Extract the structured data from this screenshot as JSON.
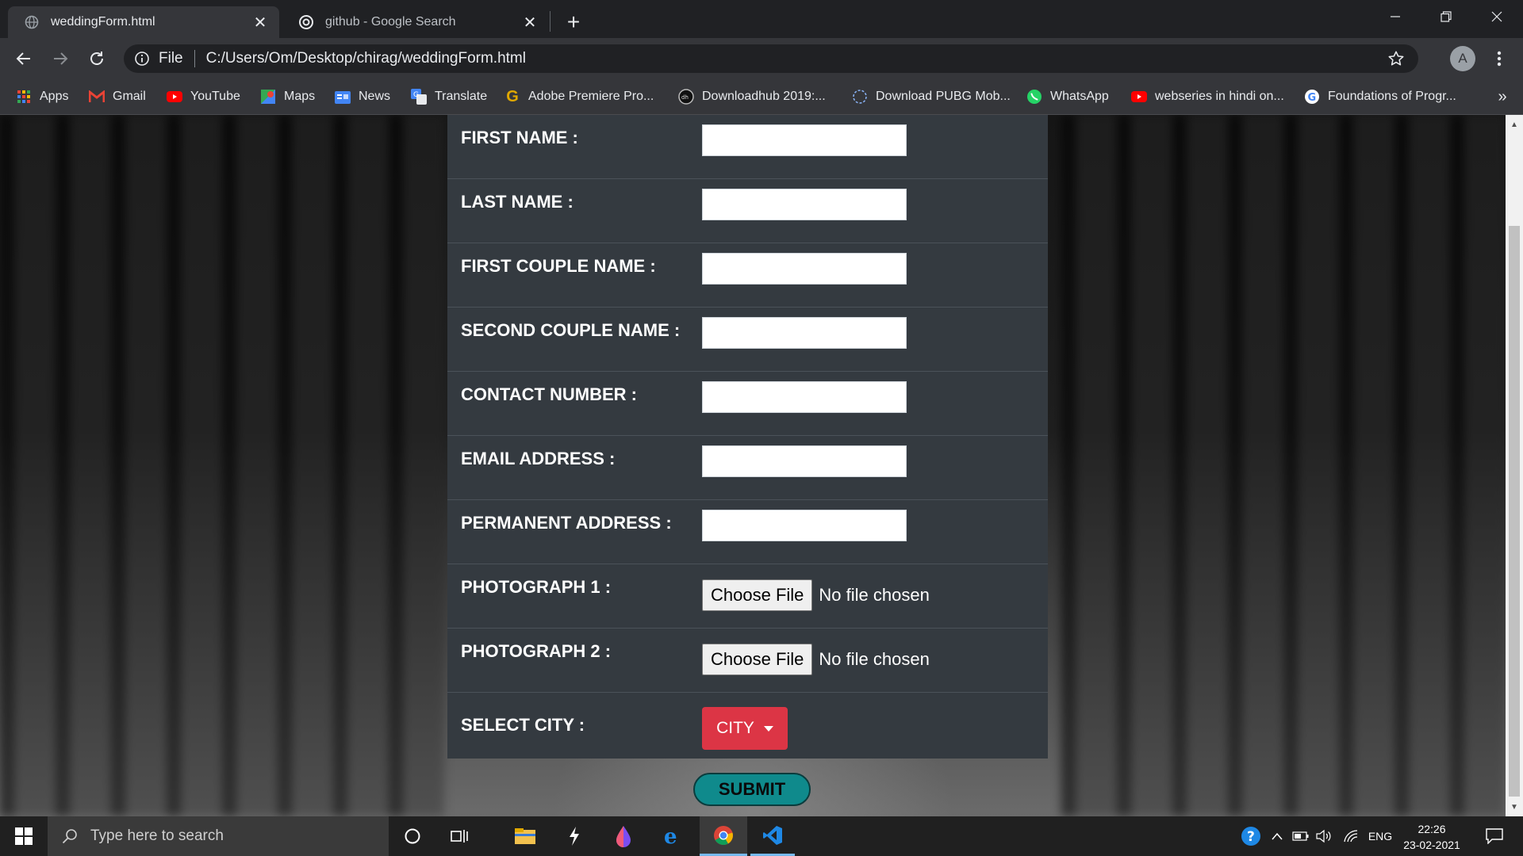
{
  "browser": {
    "tabs": [
      {
        "title": "weddingForm.html",
        "active": true,
        "icon": "globe-icon"
      },
      {
        "title": "github - Google Search",
        "active": false,
        "icon": "google-icon"
      }
    ],
    "omnibox": {
      "scheme_label": "File",
      "url": "C:/Users/Om/Desktop/chirag/weddingForm.html"
    },
    "profile_initial": "A",
    "bookmarks": [
      {
        "label": "Apps",
        "icon": "apps-grid-icon"
      },
      {
        "label": "Gmail",
        "icon": "gmail-icon"
      },
      {
        "label": "YouTube",
        "icon": "youtube-icon"
      },
      {
        "label": "Maps",
        "icon": "maps-icon"
      },
      {
        "label": "News",
        "icon": "news-icon"
      },
      {
        "label": "Translate",
        "icon": "translate-icon"
      },
      {
        "label": "Adobe Premiere Pro...",
        "icon": "g-letter-icon"
      },
      {
        "label": "Downloadhub 2019:...",
        "icon": "downloadhub-icon"
      },
      {
        "label": "Download PUBG Mob...",
        "icon": "pubg-icon"
      },
      {
        "label": "WhatsApp",
        "icon": "whatsapp-icon"
      },
      {
        "label": "webseries in hindi on...",
        "icon": "youtube-icon"
      },
      {
        "label": "Foundations of Progr...",
        "icon": "google-icon"
      }
    ],
    "bookmarks_overflow": "»"
  },
  "form": {
    "fields": [
      {
        "label": "FIRST NAME :",
        "value": ""
      },
      {
        "label": "LAST NAME :",
        "value": ""
      },
      {
        "label": "FIRST COUPLE NAME :",
        "value": ""
      },
      {
        "label": "SECOND COUPLE NAME :",
        "value": ""
      },
      {
        "label": "CONTACT NUMBER :",
        "value": ""
      },
      {
        "label": "EMAIL ADDRESS :",
        "value": ""
      },
      {
        "label": "PERMANENT ADDRESS :",
        "value": ""
      }
    ],
    "photos": [
      {
        "label": "PHOTOGRAPH 1 :",
        "button": "Choose File",
        "status": "No file chosen"
      },
      {
        "label": "PHOTOGRAPH 2 :",
        "button": "Choose File",
        "status": "No file chosen"
      }
    ],
    "city": {
      "label": "SELECT CITY :",
      "button": "CITY"
    },
    "submit": "SUBMIT",
    "colors": {
      "card": "#343a40",
      "city_button": "#dc3545",
      "submit_button": "#0f8a8c"
    }
  },
  "taskbar": {
    "search_placeholder": "Type here to search",
    "language": "ENG",
    "time": "22:26",
    "date": "23-02-2021",
    "pinned": [
      "cortana-icon",
      "task-view-icon",
      "file-explorer-icon",
      "winamp-icon",
      "color-drop-icon",
      "edge-icon",
      "chrome-icon",
      "vscode-icon"
    ]
  }
}
